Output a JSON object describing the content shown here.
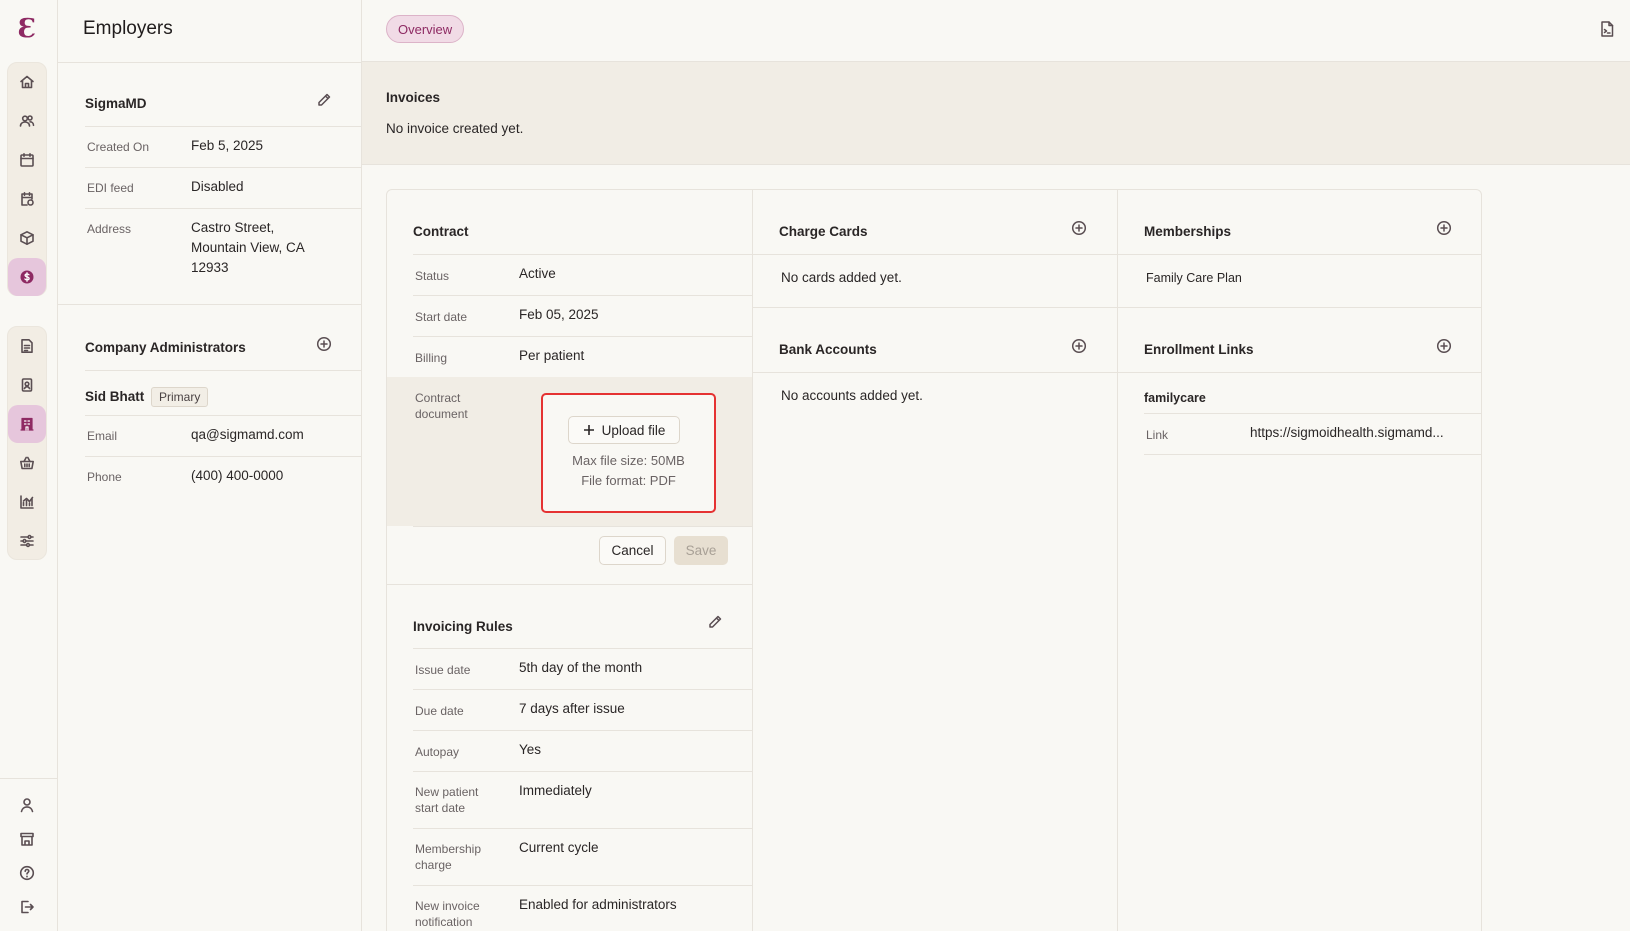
{
  "page_title": "Employers",
  "rail": {
    "primary_icons": [
      "home-icon",
      "users-icon",
      "calendar-icon",
      "calendar-check-icon",
      "cube-icon",
      "dollar-icon"
    ],
    "secondary_icons": [
      "document-icon",
      "badge-icon",
      "building-icon",
      "basket-icon",
      "chart-icon",
      "sliders-icon"
    ],
    "bottom_icons": [
      "user-icon",
      "store-icon",
      "help-icon",
      "logout-icon"
    ],
    "accent": "#8e2a63"
  },
  "employer": {
    "name": "SigmaMD",
    "fields": [
      {
        "label": "Created On",
        "value": "Feb 5, 2025"
      },
      {
        "label": "EDI feed",
        "value": "Disabled"
      },
      {
        "label": "Address",
        "value": "Castro Street,\nMountain View, CA\n12933"
      }
    ]
  },
  "admins": {
    "title": "Company Administrators",
    "name": "Sid Bhatt",
    "badge": "Primary",
    "fields": [
      {
        "label": "Email",
        "value": "qa@sigmamd.com"
      },
      {
        "label": "Phone",
        "value": "(400) 400-0000"
      }
    ]
  },
  "tabs": {
    "overview": "Overview"
  },
  "invoices": {
    "title": "Invoices",
    "empty": "No invoice created yet."
  },
  "contract": {
    "title": "Contract",
    "fields": [
      {
        "label": "Status",
        "value": "Active"
      },
      {
        "label": "Start date",
        "value": "Feb 05, 2025"
      },
      {
        "label": "Billing",
        "value": "Per patient"
      }
    ],
    "doc_label": "Contract\ndocument",
    "upload_label": "Upload file",
    "max_size": "Max file size: 50MB",
    "format": "File format: PDF",
    "cancel": "Cancel",
    "save": "Save"
  },
  "invoicing_rules": {
    "title": "Invoicing Rules",
    "fields": [
      {
        "label": "Issue date",
        "value": "5th day of the month"
      },
      {
        "label": "Due date",
        "value": "7 days after issue"
      },
      {
        "label": "Autopay",
        "value": "Yes"
      },
      {
        "label": "New patient\nstart date",
        "value": "Immediately"
      },
      {
        "label": "Membership\ncharge",
        "value": "Current cycle"
      },
      {
        "label": "New invoice\nnotification",
        "value": "Enabled for administrators"
      }
    ]
  },
  "charge_cards": {
    "title": "Charge Cards",
    "empty": "No cards added yet."
  },
  "bank_accounts": {
    "title": "Bank Accounts",
    "empty": "No accounts added yet."
  },
  "memberships": {
    "title": "Memberships",
    "items": [
      "Family Care Plan"
    ]
  },
  "enrollment_links": {
    "title": "Enrollment Links",
    "name": "familycare",
    "link_label": "Link",
    "link_value": "https://sigmoidhealth.sigmamd..."
  }
}
